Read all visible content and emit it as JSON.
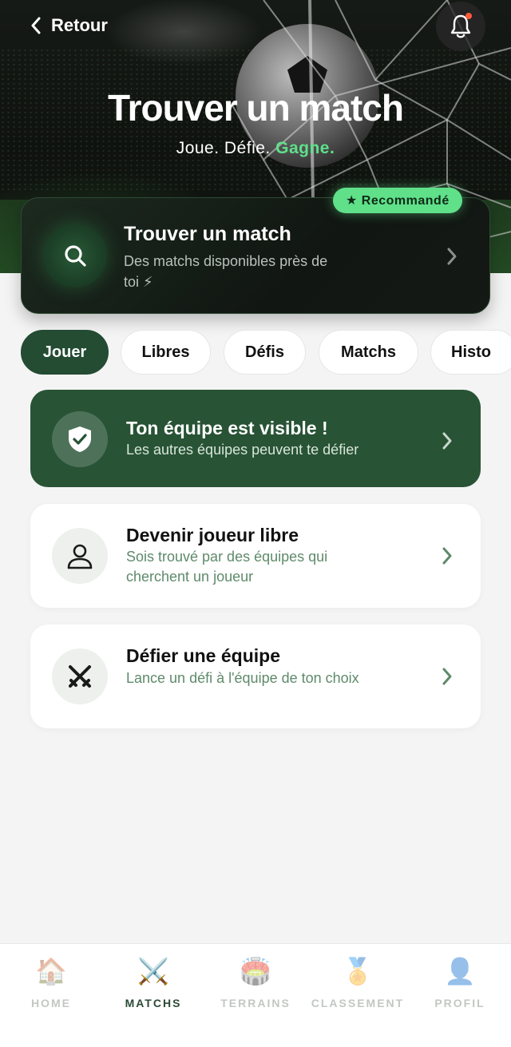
{
  "header": {
    "back_label": "Retour",
    "title": "Trouver un match",
    "subtitle_plain": "Joue. Défie. ",
    "subtitle_accent": "Gagne."
  },
  "find_card": {
    "badge": "★ Recommandé",
    "title": "Trouver un match",
    "description": "Des matchs disponibles près de toi ⚡"
  },
  "tabs": [
    {
      "label": "Jouer",
      "active": true
    },
    {
      "label": "Libres",
      "active": false
    },
    {
      "label": "Défis",
      "active": false
    },
    {
      "label": "Matchs",
      "active": false
    },
    {
      "label": "Histo",
      "active": false
    }
  ],
  "cards": {
    "visible": {
      "title": "Ton équipe est visible !",
      "subtitle": "Les autres équipes peuvent te défier"
    },
    "free_player": {
      "title": "Devenir joueur libre",
      "subtitle": "Sois trouvé par des équipes qui cherchent un joueur"
    },
    "challenge": {
      "title": "Défier une équipe",
      "subtitle": "Lance un défi à l'équipe de ton choix"
    }
  },
  "bottom_nav": [
    {
      "label": "HOME",
      "emoji": "🏠",
      "icon": "home-icon",
      "active": false
    },
    {
      "label": "MATCHS",
      "emoji": "⚔️",
      "icon": "crossed-swords-icon",
      "active": true
    },
    {
      "label": "TERRAINS",
      "emoji": "🏟️",
      "icon": "stadium-icon",
      "active": false
    },
    {
      "label": "CLASSEMENT",
      "emoji": "🏅",
      "icon": "medal-icon",
      "active": false
    },
    {
      "label": "PROFIL",
      "emoji": "👤",
      "icon": "profile-icon",
      "active": false
    }
  ],
  "colors": {
    "accent_green": "#5ee08a",
    "dark_green": "#234c33",
    "card_green": "#285335",
    "notification_dot": "#ff5a3c"
  }
}
